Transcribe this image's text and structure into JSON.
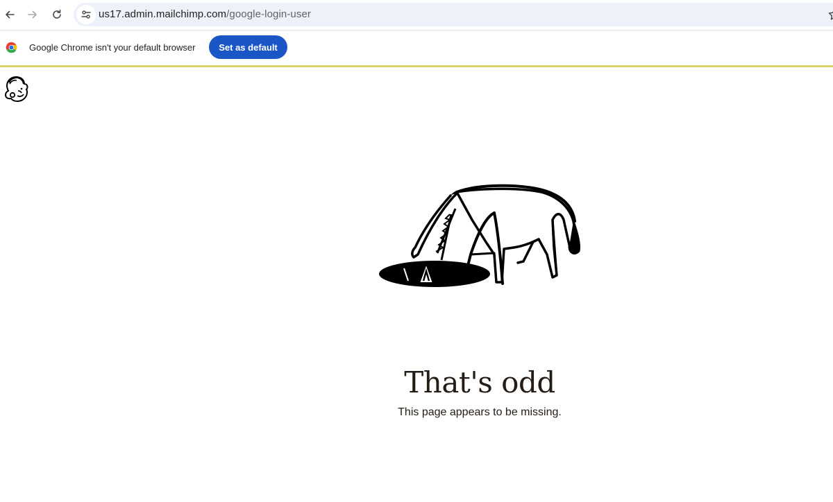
{
  "browser": {
    "url_domain": "us17.admin.mailchimp.com",
    "url_path": "/google-login-user",
    "infobar_message": "Google Chrome isn't your default browser",
    "set_default_label": "Set as default",
    "icons": [
      "back-arrow-icon",
      "forward-arrow-icon",
      "reload-icon",
      "site-info-icon",
      "bookmark-star-icon",
      "chrome-logo-icon"
    ]
  },
  "page": {
    "headline": "That's odd",
    "message": "This page appears to be missing.",
    "logo": "mailchimp-freddie-logo",
    "illustration": "horse-head-in-hole-illustration",
    "colors": {
      "text": "#241c15",
      "accent_line": "#d8d26a",
      "button": "#1b56c7"
    }
  }
}
